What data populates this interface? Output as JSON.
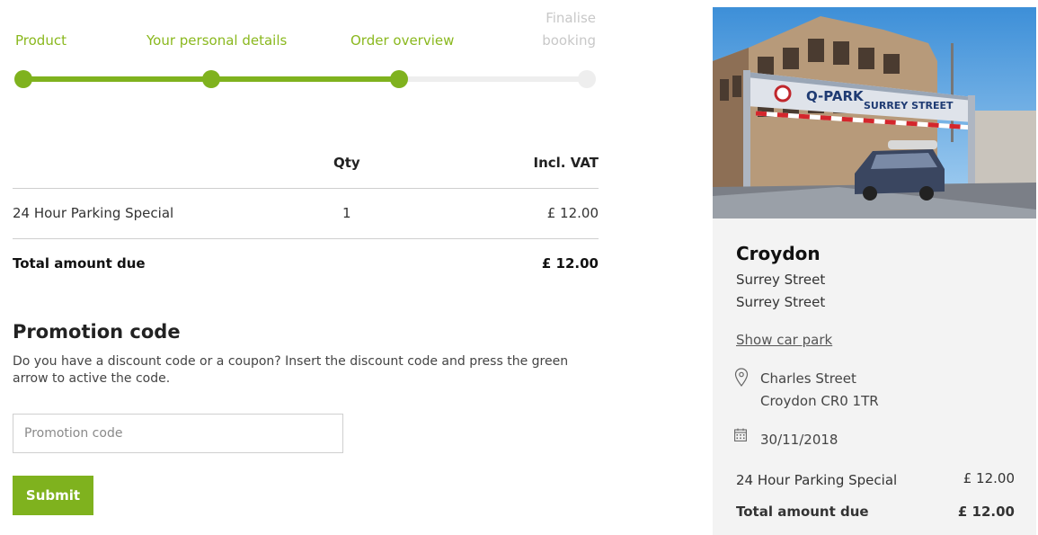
{
  "stepper": {
    "steps": [
      {
        "label": "Product",
        "state": "done"
      },
      {
        "label": "Your personal details",
        "state": "done"
      },
      {
        "label": "Order overview",
        "state": "current"
      },
      {
        "label_line1": "Finalise",
        "label_line2": "booking",
        "state": "todo"
      }
    ],
    "progress": 0.667
  },
  "summary": {
    "col_qty": "Qty",
    "col_price": "Incl. VAT",
    "rows": [
      {
        "product": "24 Hour Parking Special",
        "qty": "1",
        "price": "£ 12.00"
      }
    ],
    "total_label": "Total amount due",
    "total_value": "£ 12.00"
  },
  "promo": {
    "title": "Promotion code",
    "description": "Do you have a discount code or a coupon? Insert the discount code and press the green arrow to active the code.",
    "placeholder": "Promotion code",
    "value": "",
    "submit_label": "Submit"
  },
  "carpark": {
    "city": "Croydon",
    "street_line1": "Surrey Street",
    "street_line2": "Surrey Street",
    "show_link": "Show car park",
    "address_line1": "Charles Street",
    "address_line2": "Croydon CR0 1TR",
    "date": "30/11/2018",
    "item_label": "24 Hour Parking Special",
    "item_price": "£ 12.00",
    "total_label": "Total amount due",
    "total_value": "£ 12.00",
    "photo_signage": {
      "brand": "Q-PARK",
      "street": "SURREY STREET"
    }
  },
  "colors": {
    "accent": "#7fb21e",
    "inactive": "#eeeeee",
    "panel_bg": "#f3f3f3"
  }
}
